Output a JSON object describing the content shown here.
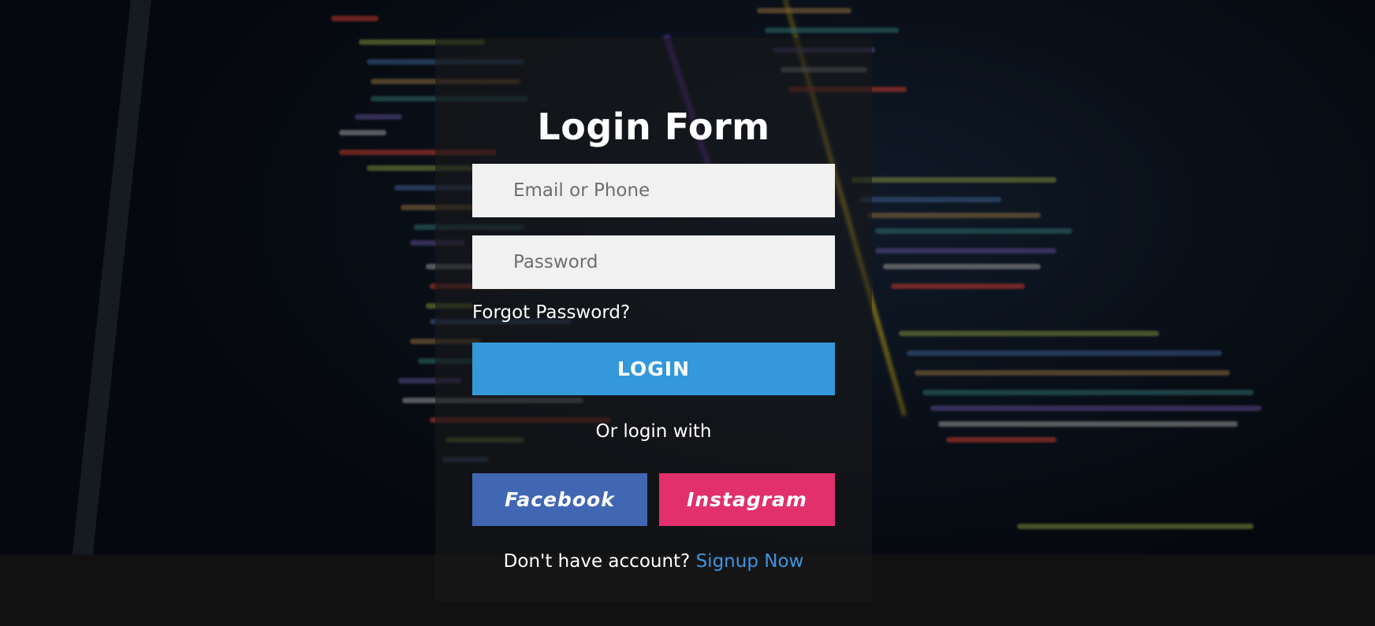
{
  "form": {
    "title": "Login Form",
    "email_placeholder": "Email or Phone",
    "password_placeholder": "Password",
    "forgot_password": "Forgot Password?",
    "login_label": "LOGIN",
    "or_text": "Or login with",
    "facebook_label": "Facebook",
    "instagram_label": "Instagram",
    "signup_prompt": "Don't have account?",
    "signup_link": "Signup Now"
  },
  "colors": {
    "login_button": "#3498db",
    "facebook_button": "#4267b2",
    "instagram_button": "#e1306c",
    "link": "#3c95e0",
    "input_background": "#f1f1f1"
  }
}
